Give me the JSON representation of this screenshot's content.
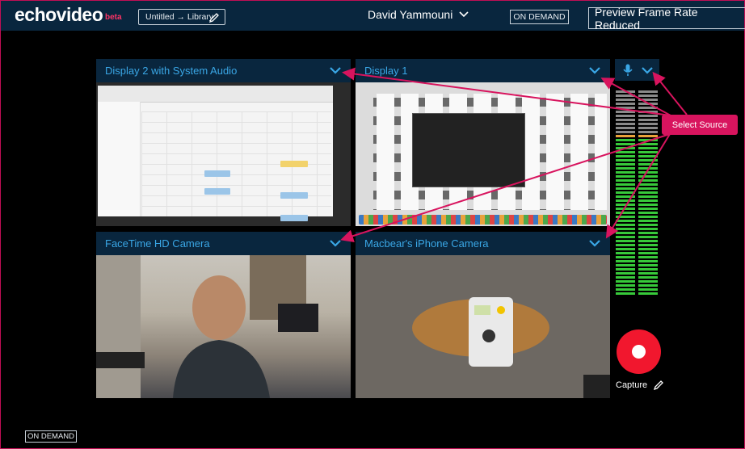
{
  "header": {
    "logo": "echovideo",
    "logo_badge": "beta",
    "library_label": "Untitled → Library",
    "user_name": "David Yammouni",
    "mode_badge": "ON DEMAND",
    "preview_notice": "Preview Frame Rate Reduced"
  },
  "sources": [
    {
      "title": "Display 2 with System Audio"
    },
    {
      "title": "Display 1"
    },
    {
      "title": "FaceTime HD Camera"
    },
    {
      "title": "Macbear's iPhone Camera"
    }
  ],
  "audio": {
    "mic_icon": "microphone-icon"
  },
  "capture": {
    "label": "Capture"
  },
  "footer": {
    "mode_badge": "ON DEMAND"
  },
  "callout": {
    "text": "Select Source"
  },
  "colors": {
    "header_bg": "#09263e",
    "accent_blue": "#3aa7e6",
    "record_red": "#f1172e",
    "callout_pink": "#d8145e",
    "meter_green": "#37c93a",
    "meter_orange": "#e9a23b",
    "meter_gray": "#8a8a8a"
  }
}
